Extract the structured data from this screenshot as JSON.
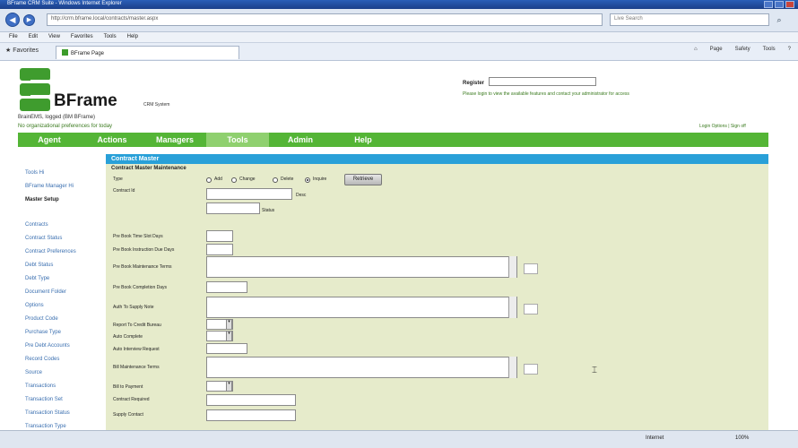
{
  "browser": {
    "window_title": "BFrame CRM Suite - Windows Internet Explorer",
    "url": "http://crm.bframe.local/contracts/master.aspx",
    "search_placeholder": "Live Search",
    "menu": [
      "File",
      "Edit",
      "View",
      "Favorites",
      "Tools",
      "Help"
    ],
    "favorites_label": "Favorites",
    "tab_title": "BFrame Page",
    "command_items": [
      "Page",
      "Safety",
      "Tools"
    ],
    "status_zone": "Internet",
    "status_zoom": "100%"
  },
  "header": {
    "brand": "BFrame",
    "brand_sub": "CRM System",
    "login_line": "BrainEMS, logged (BM BFrame)",
    "status_line": "No organizational preferences for today",
    "login_label": "Register",
    "info_note": "Please login to view the available features and contact your administrator for access",
    "top_links": "Login Options | Sign off"
  },
  "nav": {
    "items": [
      {
        "label": "Agent"
      },
      {
        "label": "Actions"
      },
      {
        "label": "Managers"
      },
      {
        "label": "Tools"
      },
      {
        "label": "Admin"
      },
      {
        "label": "Help"
      }
    ]
  },
  "sidebar": {
    "items": [
      {
        "label": "Tools Hi"
      },
      {
        "label": "BFrame Manager Hi"
      },
      {
        "label": "Master Setup"
      },
      {
        "label": ""
      },
      {
        "label": "Contracts"
      },
      {
        "label": "Contract Status"
      },
      {
        "label": "Contract Preferences"
      },
      {
        "label": "Debt Status"
      },
      {
        "label": "Debt Type"
      },
      {
        "label": "Document Folder"
      },
      {
        "label": "Options"
      },
      {
        "label": "Product Code"
      },
      {
        "label": "Purchase Type"
      },
      {
        "label": "Pre Debt Accounts"
      },
      {
        "label": "Record Codes"
      },
      {
        "label": "Source"
      },
      {
        "label": "Transactions"
      },
      {
        "label": "Transaction Set"
      },
      {
        "label": "Transaction Status"
      },
      {
        "label": "Transaction Type"
      }
    ]
  },
  "panel": {
    "title": "Contract Master",
    "subtitle": "Contract Master Maintenance",
    "type_label": "Type",
    "type_options": [
      "Add",
      "Change",
      "Delete",
      "Inquire"
    ],
    "type_selected": 3,
    "retrieve_button": "Retrieve",
    "contract_id_label": "Contract Id",
    "desc_label": "Desc",
    "status_label": "Status",
    "fields": [
      "Pre Book Time Slot Days",
      "Pre Book Instruction Due Days",
      "Pre Book Maintenance Terms",
      "Pre Book Completion Days",
      "Auth To Supply Note",
      "Report To Credit Bureau",
      "Auto Complete",
      "Auto Interview Request",
      "Bill Maintenance Terms",
      "Bill to Payment",
      "Contract Required",
      "Supply Contact"
    ]
  }
}
